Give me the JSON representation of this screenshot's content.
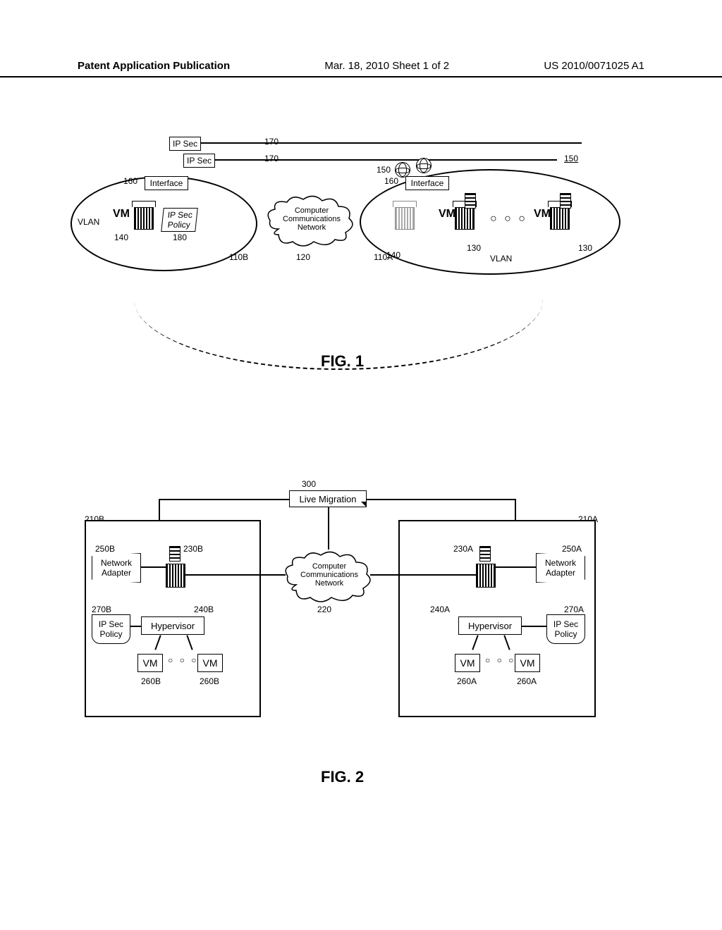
{
  "header": {
    "left": "Patent Application Publication",
    "mid": "Mar. 18, 2010  Sheet 1 of 2",
    "right": "US 2010/0071025 A1"
  },
  "fig1": {
    "caption": "FIG. 1",
    "ipsec_top1": "IP Sec",
    "ipsec_top2": "IP Sec",
    "interface_left": "Interface",
    "interface_right": "Interface",
    "policy": "IP Sec\nPolicy",
    "cloud": "Computer\nCommunications\nNetwork",
    "vlan_left": "VLAN",
    "vlan_right": "VLAN",
    "vm": "VM",
    "ref": {
      "n170a": "170",
      "n170b": "170",
      "n150a": "150",
      "n150b": "150",
      "n160a": "160",
      "n160b": "160",
      "n140a": "140",
      "n140b": "140",
      "n130a": "130",
      "n130b": "130",
      "n180": "180",
      "n120": "120",
      "n110a": "110A",
      "n110b": "110B"
    }
  },
  "fig2": {
    "caption": "FIG. 2",
    "live_migration": "Live Migration",
    "cloud": "Computer\nCommunications\nNetwork",
    "network_adapter": "Network\nAdapter",
    "hypervisor": "Hypervisor",
    "ipsec_policy": "IP Sec\nPolicy",
    "vm": "VM",
    "ref": {
      "n300": "300",
      "n210a": "210A",
      "n210b": "210B",
      "n250a": "250A",
      "n250b": "250B",
      "n230a": "230A",
      "n230b": "230B",
      "n240a": "240A",
      "n240b": "240B",
      "n270a": "270A",
      "n270b": "270B",
      "n260a1": "260A",
      "n260a2": "260A",
      "n260b1": "260B",
      "n260b2": "260B",
      "n220": "220"
    }
  }
}
